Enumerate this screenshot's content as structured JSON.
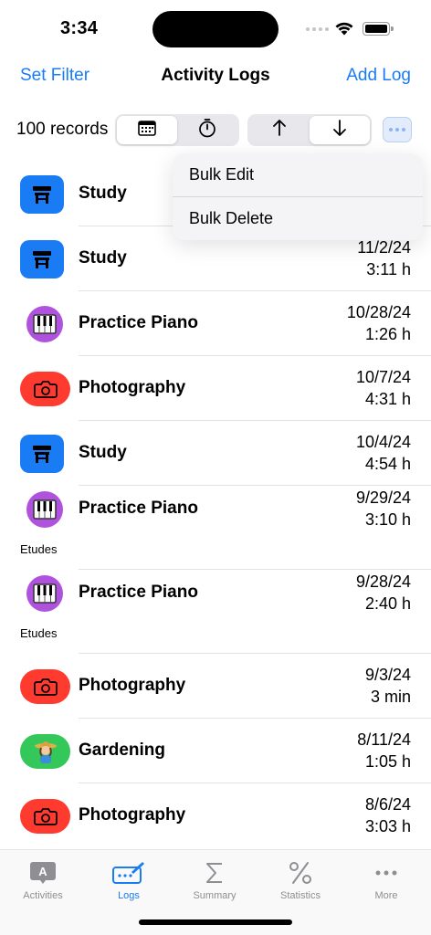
{
  "status": {
    "time": "3:34"
  },
  "nav": {
    "left": "Set Filter",
    "title": "Activity Logs",
    "right": "Add Log"
  },
  "toolbar": {
    "record_count": "100 records"
  },
  "menu": {
    "items": [
      "Bulk Edit",
      "Bulk Delete"
    ]
  },
  "logs": [
    {
      "name": "Study",
      "date": "",
      "duration": "",
      "note": "",
      "icon": "desk-icon",
      "color": "#1a7cf5"
    },
    {
      "name": "Study",
      "date": "11/2/24",
      "duration": "3:11 h",
      "note": "",
      "icon": "desk-icon",
      "color": "#1a7cf5"
    },
    {
      "name": "Practice Piano",
      "date": "10/28/24",
      "duration": "1:26 h",
      "note": "",
      "icon": "piano-icon",
      "color": "#af52de"
    },
    {
      "name": "Photography",
      "date": "10/7/24",
      "duration": "4:31 h",
      "note": "",
      "icon": "camera-icon",
      "color": "#ff3b30"
    },
    {
      "name": "Study",
      "date": "10/4/24",
      "duration": "4:54 h",
      "note": "",
      "icon": "desk-icon",
      "color": "#1a7cf5"
    },
    {
      "name": "Practice Piano",
      "date": "9/29/24",
      "duration": "3:10 h",
      "note": "Etudes",
      "icon": "piano-icon",
      "color": "#af52de"
    },
    {
      "name": "Practice Piano",
      "date": "9/28/24",
      "duration": "2:40 h",
      "note": "Etudes",
      "icon": "piano-icon",
      "color": "#af52de"
    },
    {
      "name": "Photography",
      "date": "9/3/24",
      "duration": "3 min",
      "note": "",
      "icon": "camera-icon",
      "color": "#ff3b30"
    },
    {
      "name": "Gardening",
      "date": "8/11/24",
      "duration": "1:05 h",
      "note": "",
      "icon": "farmer-icon",
      "color": "#34c759"
    },
    {
      "name": "Photography",
      "date": "8/6/24",
      "duration": "3:03 h",
      "note": "",
      "icon": "camera-icon",
      "color": "#ff3b30"
    }
  ],
  "tabs": [
    {
      "label": "Activities",
      "icon": "activities-icon",
      "active": false
    },
    {
      "label": "Logs",
      "icon": "logs-icon",
      "active": true
    },
    {
      "label": "Summary",
      "icon": "sigma-icon",
      "active": false
    },
    {
      "label": "Statistics",
      "icon": "percent-icon",
      "active": false
    },
    {
      "label": "More",
      "icon": "ellipsis-icon",
      "active": false
    }
  ]
}
